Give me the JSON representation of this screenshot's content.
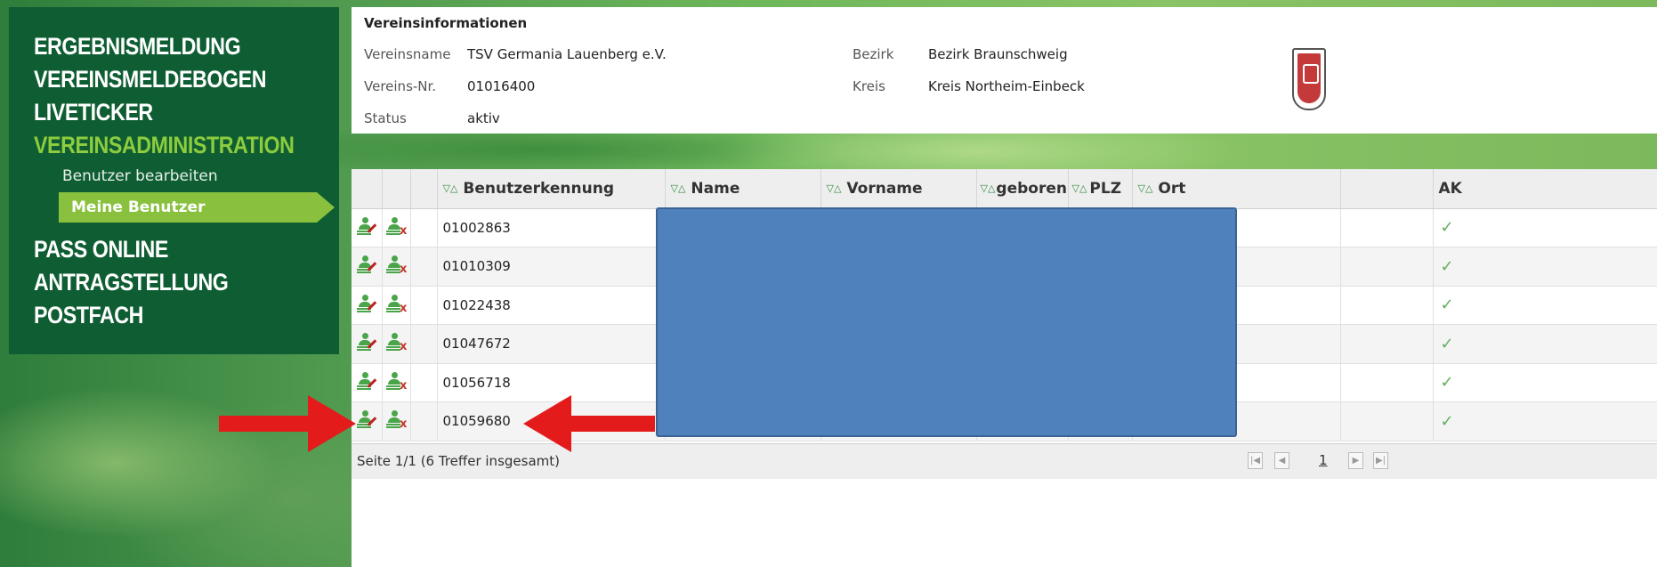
{
  "sidebar": {
    "main_items": [
      "ERGEBNISMELDUNG",
      "VEREINSMELDEBOGEN",
      "LIVETICKER",
      "VEREINSADMINISTRATION"
    ],
    "sub_items": [
      "Benutzer bearbeiten",
      "Meine Benutzer"
    ],
    "lower_items": [
      "PASS ONLINE",
      "ANTRAGSTELLUNG",
      "POSTFACH"
    ]
  },
  "info": {
    "title": "Vereinsinformationen",
    "vereinsname_label": "Vereinsname",
    "vereinsname": "TSV Germania Lauenberg e.V.",
    "vereinsnr_label": "Vereins-Nr.",
    "vereinsnr": "01016400",
    "status_label": "Status",
    "status": "aktiv",
    "bezirk_label": "Bezirk",
    "bezirk": "Bezirk Braunschweig",
    "kreis_label": "Kreis",
    "kreis": "Kreis Northeim-Einbeck"
  },
  "table": {
    "sort_glyph": "▽△",
    "columns": [
      "Benutzerkennung",
      "Name",
      "Vorname",
      "geboren",
      "PLZ",
      "Ort",
      "AK"
    ],
    "rows": [
      {
        "id": "01002863"
      },
      {
        "id": "01010309"
      },
      {
        "id": "01022438"
      },
      {
        "id": "01047672"
      },
      {
        "id": "01056718"
      },
      {
        "id": "01059680"
      }
    ],
    "check_glyph": "✓"
  },
  "footer": {
    "summary": "Seite 1/1 (6 Treffer insgesamt)",
    "current_page": "1"
  },
  "colors": {
    "sidebar_bg": "#0f5e33",
    "active_nav": "#8ccc3e",
    "sub_active_bg": "#89c13f",
    "redaction": "#4f81bd",
    "arrow": "#e31b1b"
  },
  "icons": [
    "user-edit-icon",
    "user-delete-icon",
    "sort-icon",
    "checkmark-icon",
    "club-crest-icon",
    "first-page-icon",
    "prev-page-icon",
    "next-page-icon",
    "last-page-icon",
    "red-arrow-icon"
  ]
}
